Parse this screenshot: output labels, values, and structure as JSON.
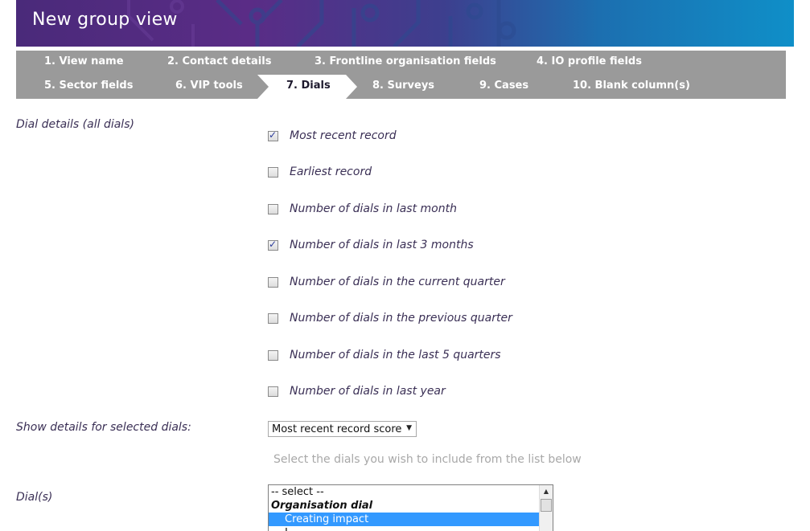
{
  "header": {
    "title": "New group view"
  },
  "tabs": [
    {
      "label": "1. View name"
    },
    {
      "label": "2. Contact details"
    },
    {
      "label": "3. Frontline organisation fields"
    },
    {
      "label": "4. IO profile fields"
    },
    {
      "label": "5. Sector fields"
    },
    {
      "label": "6. VIP tools"
    },
    {
      "label": "7. Dials",
      "active": true
    },
    {
      "label": "8. Surveys"
    },
    {
      "label": "9. Cases"
    },
    {
      "label": "10. Blank column(s)"
    }
  ],
  "dial_details": {
    "label": "Dial details (all dials)",
    "options": [
      {
        "label": "Most recent record",
        "checked": true
      },
      {
        "label": "Earliest record",
        "checked": false
      },
      {
        "label": "Number of dials in last month",
        "checked": false
      },
      {
        "label": "Number of dials in last 3 months",
        "checked": true
      },
      {
        "label": "Number of dials in the current quarter",
        "checked": false
      },
      {
        "label": "Number of dials in the previous quarter",
        "checked": false
      },
      {
        "label": "Number of dials in the last 5 quarters",
        "checked": false
      },
      {
        "label": "Number of dials in last year",
        "checked": false
      }
    ]
  },
  "selected_dials": {
    "label": "Show details for selected dials:",
    "value": "Most recent record score",
    "hint": "Select the dials you wish to include from the list below"
  },
  "dials": {
    "label": "Dial(s)",
    "options": [
      {
        "label": "-- select --",
        "kind": "plain"
      },
      {
        "label": "Organisation dial",
        "kind": "group"
      },
      {
        "label": "Creating impact",
        "kind": "selected"
      },
      {
        "label": "L",
        "kind": "child"
      }
    ]
  },
  "colors": {
    "tab_bar": "#9a9a9a",
    "selection": "#3399ff",
    "banner_start": "#4a2a7a",
    "banner_end": "#0f8fc8"
  }
}
